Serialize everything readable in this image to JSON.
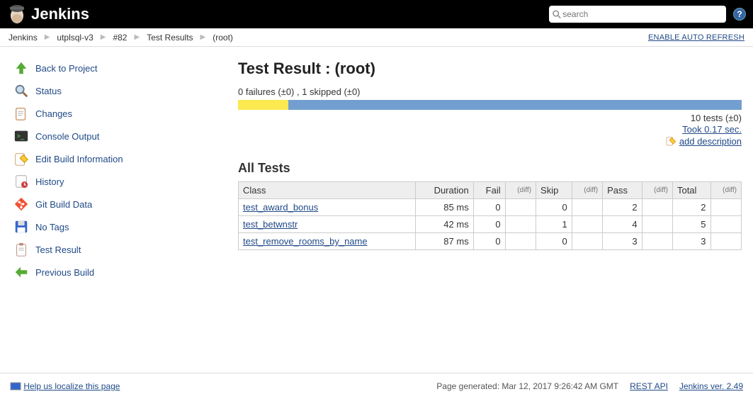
{
  "header": {
    "brand": "Jenkins",
    "search_placeholder": "search"
  },
  "breadcrumbs": {
    "items": [
      "Jenkins",
      "utplsql-v3",
      "#82",
      "Test Results",
      "(root)"
    ],
    "auto_refresh": "ENABLE AUTO REFRESH"
  },
  "sidebar": {
    "items": [
      {
        "label": "Back to Project"
      },
      {
        "label": "Status"
      },
      {
        "label": "Changes"
      },
      {
        "label": "Console Output"
      },
      {
        "label": "Edit Build Information"
      },
      {
        "label": "History"
      },
      {
        "label": "Git Build Data"
      },
      {
        "label": "No Tags"
      },
      {
        "label": "Test Result"
      },
      {
        "label": "Previous Build"
      }
    ]
  },
  "main": {
    "title": "Test Result : (root)",
    "summary": "0 failures (±0) , 1 skipped (±0)",
    "totals_tests": "10 tests (±0)",
    "took": "Took 0.17 sec.",
    "add_description": "add description",
    "section_title": "All Tests",
    "columns": {
      "class": "Class",
      "duration": "Duration",
      "fail": "Fail",
      "skip": "Skip",
      "pass": "Pass",
      "total": "Total",
      "diff": "(diff)"
    },
    "rows": [
      {
        "class": "test_award_bonus",
        "duration": "85 ms",
        "fail": "0",
        "skip": "0",
        "pass": "2",
        "total": "2"
      },
      {
        "class": "test_betwnstr",
        "duration": "42 ms",
        "fail": "0",
        "skip": "1",
        "pass": "4",
        "total": "5"
      },
      {
        "class": "test_remove_rooms_by_name",
        "duration": "87 ms",
        "fail": "0",
        "skip": "0",
        "pass": "3",
        "total": "3"
      }
    ]
  },
  "footer": {
    "help_localize": "Help us localize this page",
    "generated": "Page generated: Mar 12, 2017 9:26:42 AM GMT",
    "rest_api": "REST API",
    "version": "Jenkins ver. 2.49"
  }
}
